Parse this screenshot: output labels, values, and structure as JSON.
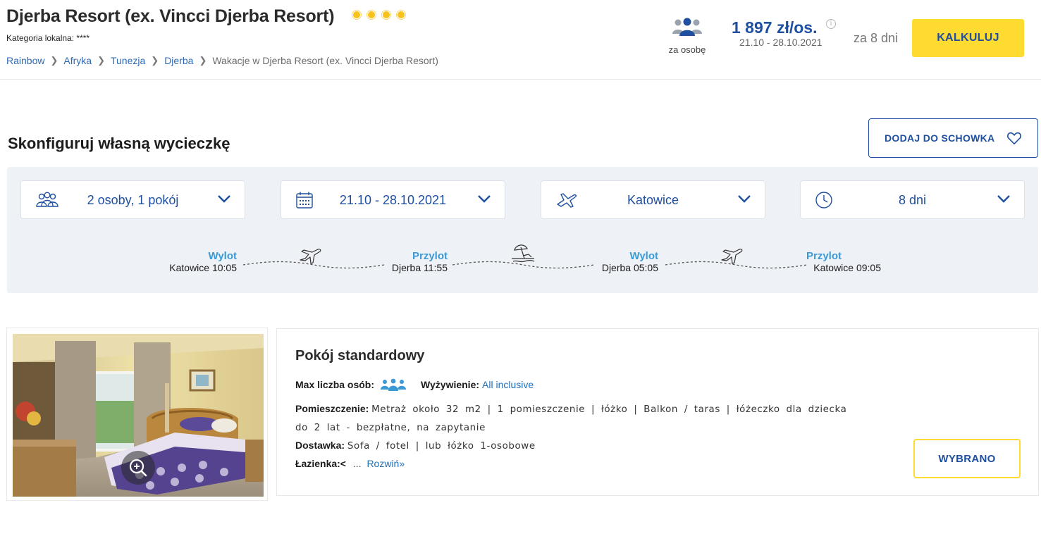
{
  "header": {
    "hotel_name": "Djerba Resort (ex. Vincci Djerba Resort)",
    "category_label": "Kategoria lokalna: ****",
    "breadcrumbs": [
      "Rainbow",
      "Afryka",
      "Tunezja",
      "Djerba"
    ],
    "breadcrumb_current": "Wakacje w Djerba Resort (ex. Vincci Djerba Resort)",
    "per_person_label": "za osobę",
    "price": "1 897 zł/os.",
    "info_icon": "i",
    "price_dates": "21.10 - 28.10.2021",
    "duration": "za 8 dni",
    "calculate_button": "KALKULUJ"
  },
  "configure": {
    "title": "Skonfiguruj własną wycieczkę",
    "favorite_button": "DODAJ DO SCHOWKA",
    "selectors": {
      "persons": "2 osoby, 1 pokój",
      "dates": "21.10 - 28.10.2021",
      "departure": "Katowice",
      "duration": "8 dni"
    },
    "flights": {
      "out_departure": {
        "label": "Wylot",
        "place_time": "Katowice 10:05"
      },
      "out_arrival": {
        "label": "Przylot",
        "place_time": "Djerba 11:55"
      },
      "back_departure": {
        "label": "Wylot",
        "place_time": "Djerba 05:05"
      },
      "back_arrival": {
        "label": "Przylot",
        "place_time": "Katowice 09:05"
      }
    }
  },
  "room": {
    "title": "Pokój standardowy",
    "max_persons_label": "Max liczba osób:",
    "board_label": "Wyżywienie:",
    "board_value": "All inclusive",
    "room_label": "Pomieszczenie:",
    "room_value": "Metraż około 32 m2 | 1 pomieszczenie | łóżko | Balkon / taras | łóżeczko dla dziecka do 2 lat - bezpłatne, na zapytanie",
    "extra_label": "Dostawka:",
    "extra_value": "Sofa / fotel | lub łóżko 1-osobowe",
    "bath_label": "Łazienka:<",
    "ellipsis": "...",
    "expand_link": "Rozwiń»",
    "select_button": "WYBRANO"
  },
  "colors": {
    "brand_blue": "#1e4fa0",
    "accent_yellow": "#fddb30",
    "light_blue": "#3b9ad6",
    "panel_bg": "#eef1f5"
  },
  "icons": [
    "people-icon",
    "calendar-icon",
    "plane-icon",
    "clock-icon",
    "chevron-down-icon",
    "heart-icon",
    "beach-umbrella-icon",
    "zoom-in-icon",
    "info-icon"
  ]
}
